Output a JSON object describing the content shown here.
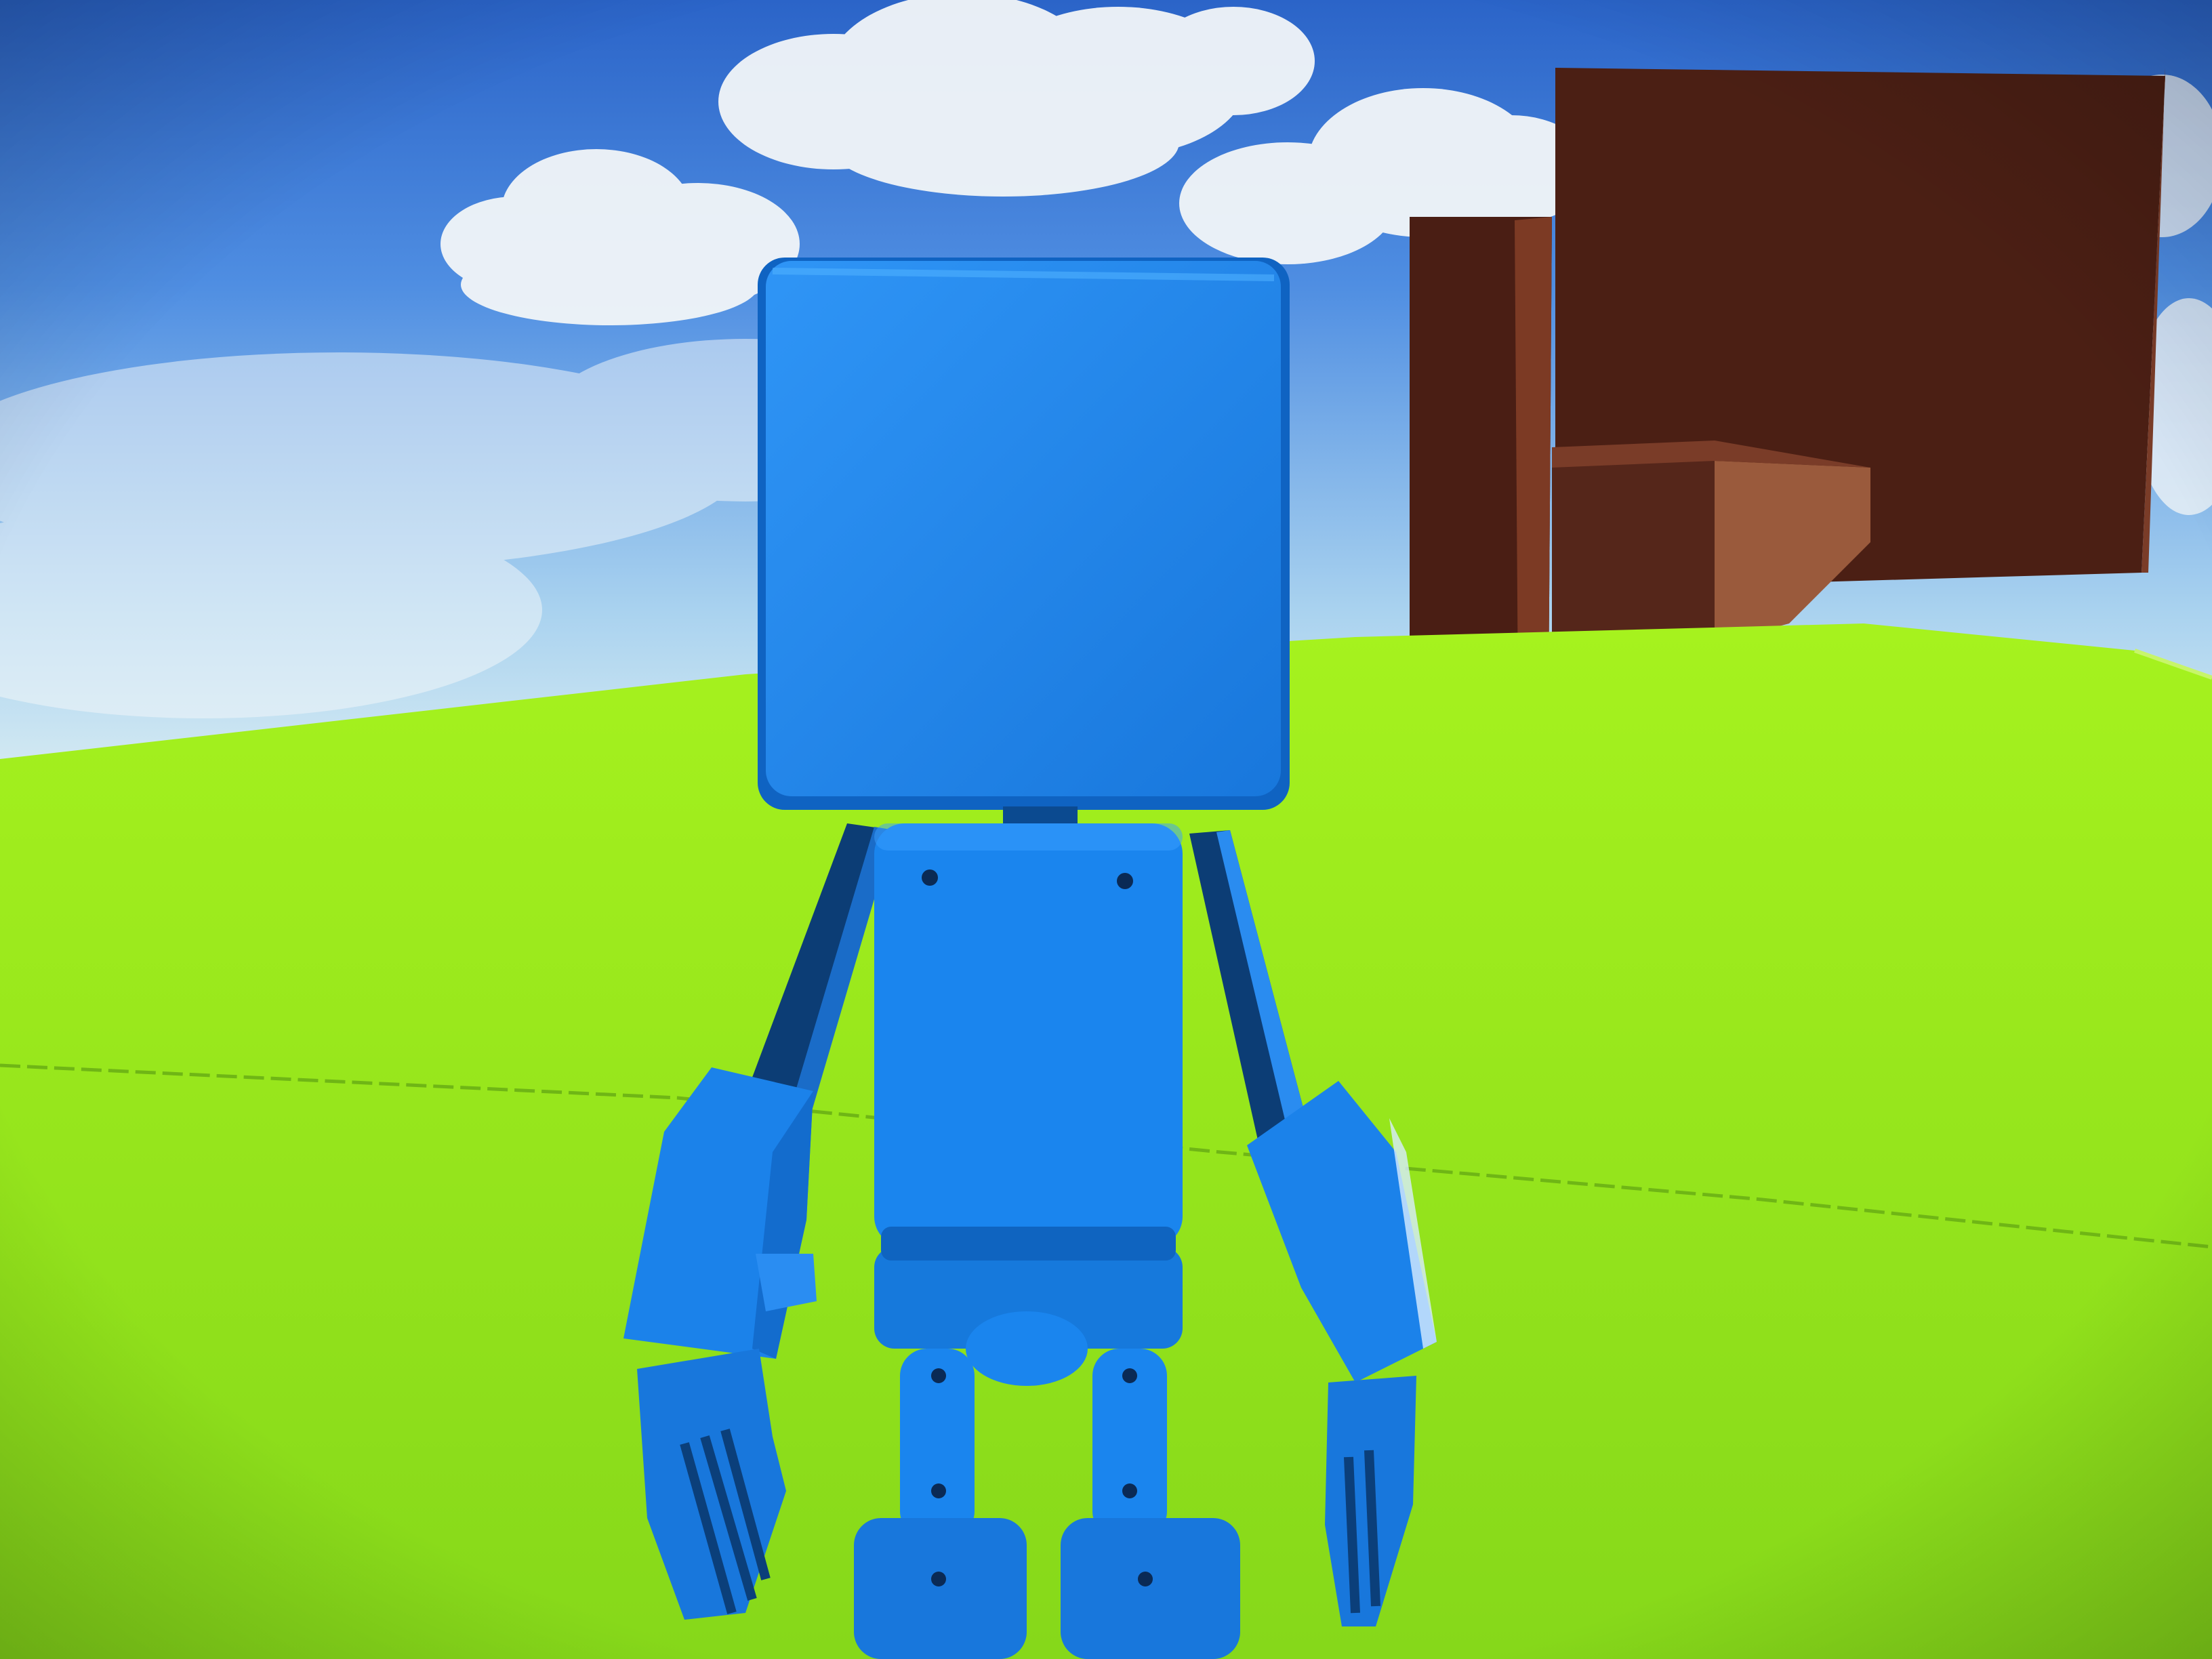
{
  "scene": {
    "colors": {
      "sky_top": "#2f6fd0",
      "sky_mid": "#5b97e6",
      "sky_horizon": "#d6ecf2",
      "cloud": "#f4f7f8",
      "ground_far": "#9cf21a",
      "ground_near": "#8fe41a",
      "ground_seam": "#6db515",
      "building_dark": "#4a1e14",
      "building_mid": "#5e2a1c",
      "building_light": "#9c5a3c",
      "robot_main": "#1a86f0",
      "robot_light": "#2f9bff",
      "robot_shadow": "#0e5fb8",
      "robot_dark": "#0b3f7a",
      "robot_hole": "#0a2a55"
    },
    "objects": {
      "player": "robot-character",
      "background": "brown-block-building"
    }
  }
}
